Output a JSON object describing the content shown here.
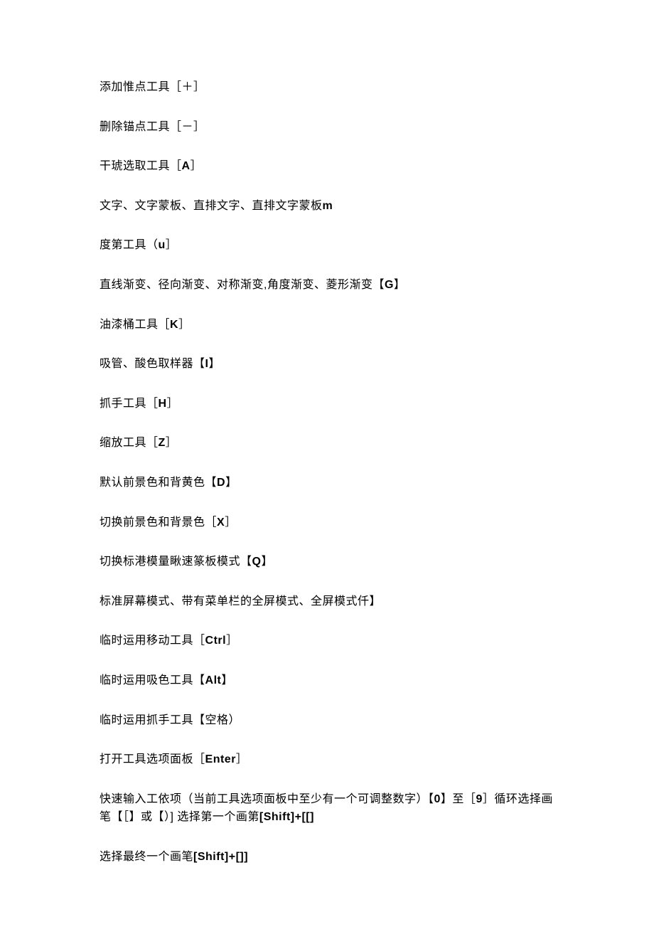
{
  "lines": [
    {
      "prefix": "添加惟点工具［＋］",
      "key": ""
    },
    {
      "prefix": "删除锚点工具［－］",
      "key": ""
    },
    {
      "prefix": "干琥选取工具［",
      "key": "A",
      "suffix": "］"
    },
    {
      "prefix": "文字、文字蒙板、直排文字、直排文字蒙板",
      "key": "m",
      "suffix": ""
    },
    {
      "prefix": "度第工具（",
      "key": "u",
      "suffix": "］"
    },
    {
      "prefix": "直线渐变、径向渐变、对称渐变,角度渐变、菱形渐变【",
      "key": "G",
      "suffix": "】"
    },
    {
      "prefix": "油漆桶工具［",
      "key": "K",
      "suffix": "］"
    },
    {
      "prefix": "吸管、酸色取样器【",
      "key": "I",
      "suffix": "】"
    },
    {
      "prefix": "抓手工具［",
      "key": "H",
      "suffix": "］"
    },
    {
      "prefix": "缩放工具［",
      "key": "Z",
      "suffix": "］"
    },
    {
      "prefix": "默认前景色和背黄色【",
      "key": "D",
      "suffix": "】"
    },
    {
      "prefix": "切换前景色和背景色［",
      "key": "X",
      "suffix": "］"
    },
    {
      "prefix": "切换标港模量瞅速篆板模式【",
      "key": "Q",
      "suffix": "】"
    },
    {
      "prefix": "标准屏幕模式、带有菜单栏的全屏模式、全屏模式仟】",
      "key": "",
      "suffix": ""
    },
    {
      "prefix": "临时运用移动工具［",
      "key": "Ctrl",
      "suffix": "］"
    },
    {
      "prefix": "临时运用吸色工具【",
      "key": "Alt",
      "suffix": "】"
    },
    {
      "prefix": "临时运用抓手工具【空格）",
      "key": "",
      "suffix": ""
    },
    {
      "prefix": "打开工具选项面板［",
      "key": "Enter",
      "suffix": "］"
    },
    {
      "prefix": "快速输入工依项（当前工具选项面板中至少有一个可调整数字）【",
      "key": "0",
      "suffix": "】至［",
      "key2": "9",
      "suffix2": "］循环选择画笔【［】或【）] 选择第一个画第",
      "key3": "[Shift]+[[]",
      "suffix3": ""
    },
    {
      "prefix": "选择最终一个画笔",
      "key": "[Shift]+[]]",
      "suffix": ""
    }
  ]
}
